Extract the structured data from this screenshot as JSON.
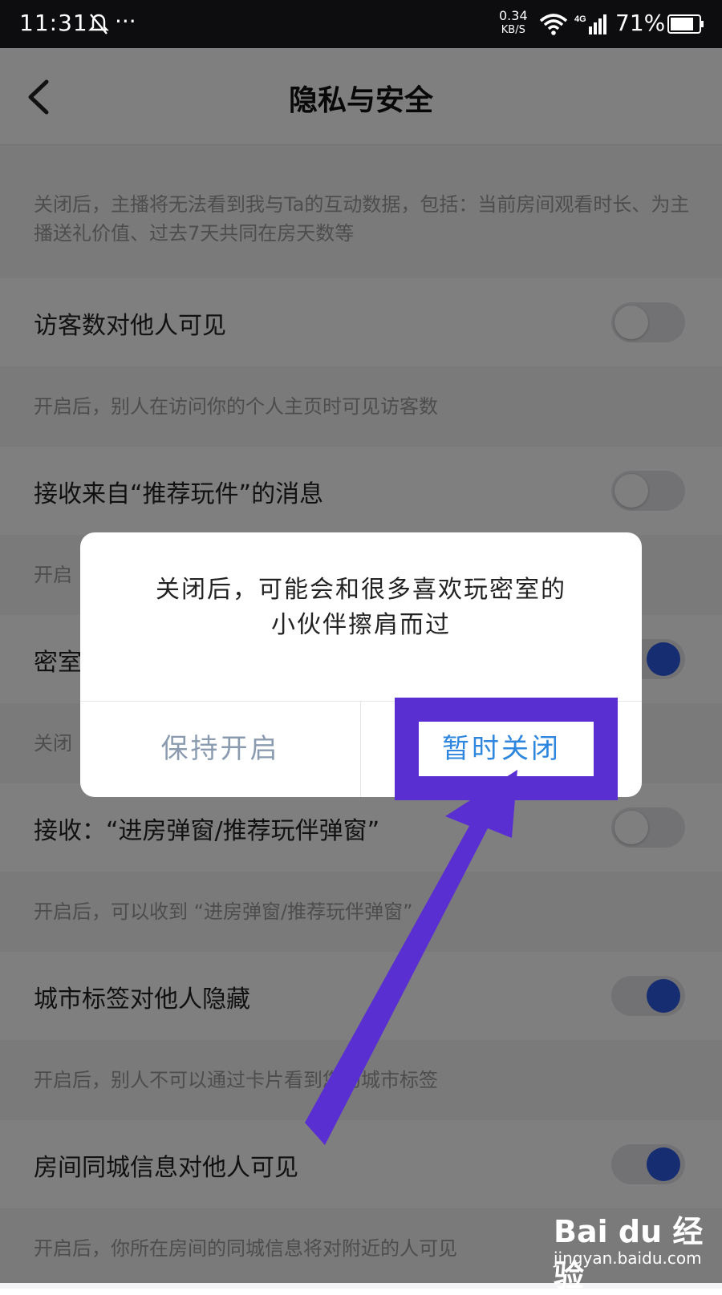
{
  "status_bar": {
    "time": "11:31",
    "more": "···",
    "speed_value": "0.34",
    "speed_unit": "KB/S",
    "network": "4G",
    "battery": "71%"
  },
  "nav": {
    "title": "隐私与安全"
  },
  "settings": {
    "top_description": "关闭后，主播将无法看到我与Ta的互动数据，包括：当前房间观看时长、为主播送礼价值、过去7天共同在房天数等",
    "items": [
      {
        "label": "访客数对他人可见",
        "hint": "开启后，别人在访问你的个人主页时可见访客数",
        "enabled": false
      },
      {
        "label": "接收来自“推荐玩件”的消息",
        "hint": "开启",
        "enabled": false
      },
      {
        "label": "密室",
        "hint": "关闭",
        "enabled": true
      },
      {
        "label": "接收：“进房弹窗/推荐玩伴弹窗”",
        "hint": "开启后，可以收到 “进房弹窗/推荐玩伴弹窗”",
        "enabled": false
      },
      {
        "label": "城市标签对他人隐藏",
        "hint": "开启后，别人不可以通过卡片看到您的城市标签",
        "enabled": true
      },
      {
        "label": "房间同城信息对他人可见",
        "hint": "开启后，你所在房间的同城信息将对附近的人可见",
        "enabled": true
      }
    ]
  },
  "dialog": {
    "message_line1": "关闭后，可能会和很多喜欢玩密室的",
    "message_line2": "小伙伴擦肩而过",
    "keep_label": "保持开启",
    "close_label": "暂时关闭"
  },
  "annotation": {
    "highlight_color": "#5a2fd2"
  },
  "watermark": {
    "brand": "Bai du 经验",
    "site": "jingyan.baidu.com"
  }
}
